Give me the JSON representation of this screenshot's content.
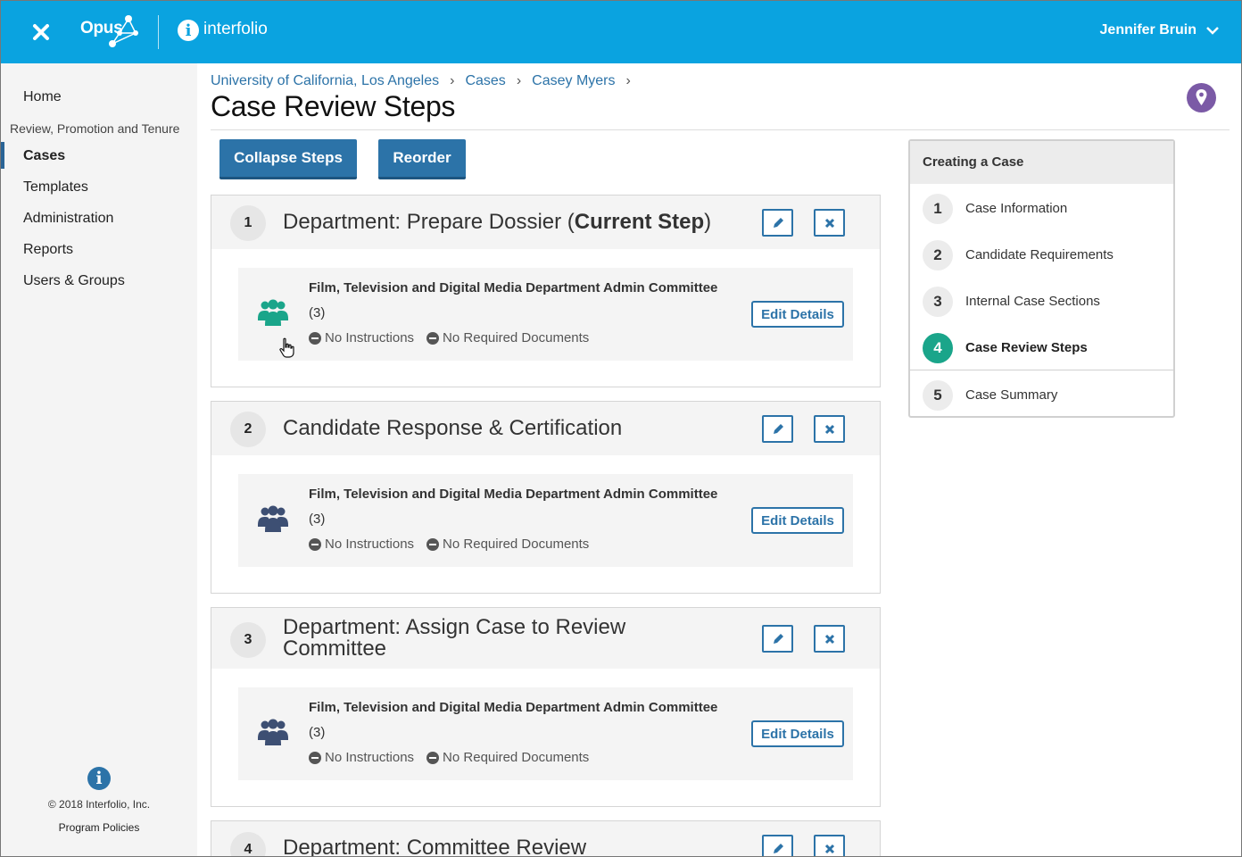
{
  "header": {
    "close_icon": "close-icon",
    "app_name": "Opus",
    "brand_name": "interfolio",
    "user_name": "Jennifer Bruin",
    "colors": {
      "bar": "#0aa3e0"
    }
  },
  "sidebar": {
    "home": "Home",
    "section": "Review, Promotion and Tenure",
    "items": [
      "Cases",
      "Templates",
      "Administration",
      "Reports",
      "Users & Groups"
    ],
    "active": "Cases",
    "copyright": "© 2018 Interfolio, Inc.",
    "policies": "Program Policies"
  },
  "breadcrumb": [
    "University of California, Los Angeles",
    "Cases",
    "Casey Myers"
  ],
  "page_title": "Case Review Steps",
  "toolbar": {
    "collapse": "Collapse Steps",
    "reorder": "Reorder"
  },
  "steps": [
    {
      "number": "1",
      "title": "Department: Prepare Dossier (",
      "title_bold": "Current Step",
      "title_end": ")",
      "committee": "Film, Television and Digital Media Department Admin Committee",
      "count": "(3)",
      "instructions": "No Instructions",
      "documents": "No Required Documents",
      "edit": "Edit Details",
      "icon_color": "#1aa58a"
    },
    {
      "number": "2",
      "title": "Candidate Response & Certification",
      "committee": "Film, Television and Digital Media Department Admin Committee",
      "count": "(3)",
      "instructions": "No Instructions",
      "documents": "No Required Documents",
      "edit": "Edit Details",
      "icon_color": "#3d4f73"
    },
    {
      "number": "3",
      "title_line1": "Department: Assign Case to Review",
      "title_line2": "Committee",
      "committee": "Film, Television and Digital Media Department Admin Committee",
      "count": "(3)",
      "instructions": "No Instructions",
      "documents": "No Required Documents",
      "edit": "Edit Details",
      "icon_color": "#3d4f73"
    },
    {
      "number": "4",
      "title": "Department: Committee Review"
    }
  ],
  "panel": {
    "title": "Creating a Case",
    "items": [
      {
        "num": "1",
        "label": "Case Information"
      },
      {
        "num": "2",
        "label": "Candidate Requirements"
      },
      {
        "num": "3",
        "label": "Internal Case Sections"
      },
      {
        "num": "4",
        "label": "Case Review Steps"
      },
      {
        "num": "5",
        "label": "Case Summary"
      }
    ],
    "active": "4",
    "active_color": "#1aa58a"
  }
}
